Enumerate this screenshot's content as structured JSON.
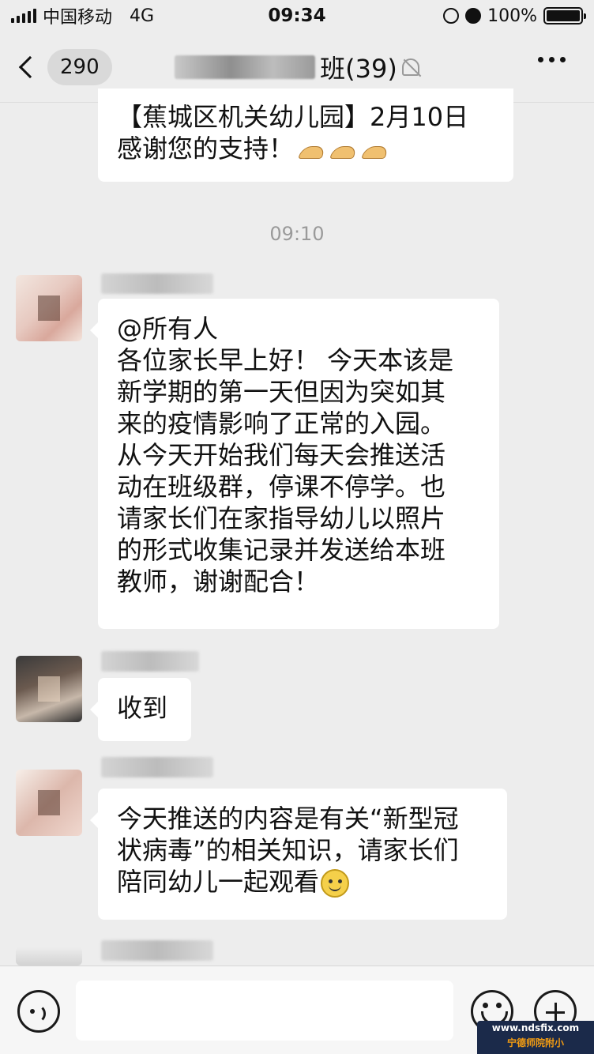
{
  "status_bar": {
    "carrier": "中国移动",
    "network": "4G",
    "time": "09:34",
    "battery": "100%"
  },
  "nav": {
    "unread_count": "290",
    "title_suffix": "班(39)"
  },
  "messages": {
    "m1": {
      "line1": "【蕉城区机关幼儿园】2月10日",
      "line2": "感谢您的支持！"
    },
    "timestamp": "09:10",
    "m2": {
      "lines": [
        "@所有人",
        "各位家长早上好！ 今天本该是",
        "新学期的第一天但因为突如其",
        "来的疫情影响了正常的入园。",
        "从今天开始我们每天会推送活",
        "动在班级群，停课不停学。也",
        "请家长们在家指导幼儿以照片",
        "的形式收集记录并发送给本班",
        "教师，谢谢配合！"
      ]
    },
    "m3": {
      "text": "收到"
    },
    "m4": {
      "line1": "今天推送的内容是有关“新型冠",
      "line2": "状病毒”的相关知识，请家长们",
      "line3": "陪同幼儿一起观看"
    }
  },
  "watermark": {
    "line1": "www.ndsfix.com",
    "line2": "宁德师院附小"
  },
  "icons": [
    "back-chevron-icon",
    "mute-icon",
    "more-icon",
    "clap-emoji-icon",
    "smile-emoji-icon",
    "voice-icon",
    "emoji-icon",
    "plus-icon",
    "signal-icon",
    "battery-icon",
    "alarm-icon",
    "rotation-lock-icon"
  ],
  "colors": {
    "background": "#ededed",
    "bubble": "#ffffff",
    "input_bar": "#f6f6f6"
  }
}
